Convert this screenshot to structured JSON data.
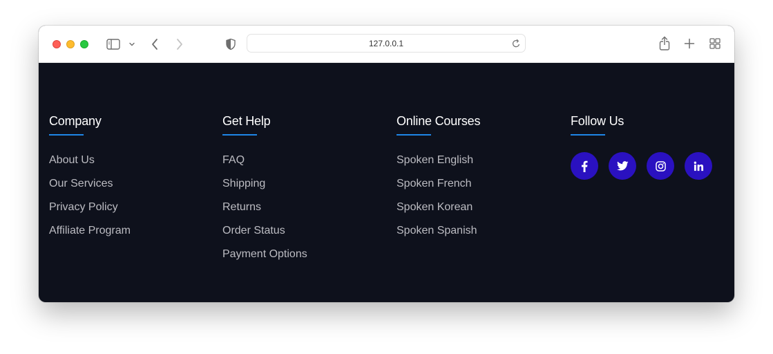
{
  "browser": {
    "url": "127.0.0.1"
  },
  "footer": {
    "columns": [
      {
        "title": "Company",
        "links": [
          "About Us",
          "Our Services",
          "Privacy Policy",
          "Affiliate Program"
        ]
      },
      {
        "title": "Get Help",
        "links": [
          "FAQ",
          "Shipping",
          "Returns",
          "Order Status",
          "Payment Options"
        ]
      },
      {
        "title": "Online Courses",
        "links": [
          "Spoken English",
          "Spoken French",
          "Spoken Korean",
          "Spoken Spanish"
        ]
      }
    ],
    "follow": {
      "title": "Follow Us",
      "icons": [
        "facebook-icon",
        "twitter-icon",
        "instagram-icon",
        "linkedin-icon"
      ]
    }
  },
  "colors": {
    "footer_bg": "#0e111c",
    "accent_underline": "#1e86e8",
    "social_bg": "#2a11c0",
    "link_text": "#bcbcc2"
  }
}
